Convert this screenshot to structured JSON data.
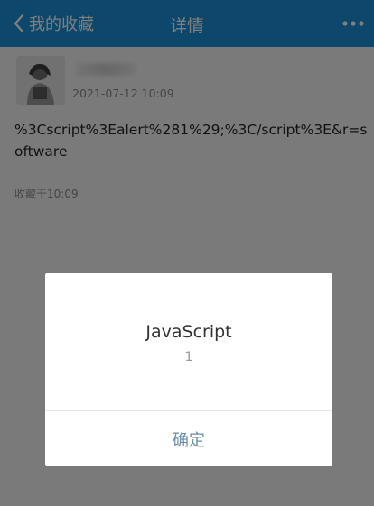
{
  "header": {
    "back_label": "我的收藏",
    "title": "详情",
    "more_icon": "more-icon"
  },
  "post": {
    "time": "2021-07-12 10:09",
    "body": "%3Cscript%3Ealert%281%29;%3C/script%3E&r=software",
    "saved_at": "收藏于10:09"
  },
  "dialog": {
    "title": "JavaScript",
    "message": "1",
    "confirm_label": "确定"
  },
  "colors": {
    "header_bg": "#1a8fd6",
    "overlay": "rgba(0,0,0,0.5)",
    "dialog_button": "#6a8dab"
  }
}
